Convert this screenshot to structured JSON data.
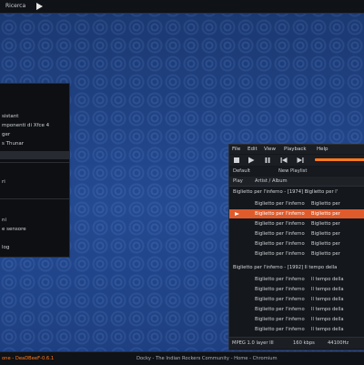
{
  "top_panel": {
    "title": "Ricerca"
  },
  "menu": {
    "items": [
      {
        "label": "sistant"
      },
      {
        "label": "mponenti di Xfce 4"
      },
      {
        "label": "ger"
      },
      {
        "label": "s Thunar"
      },
      {
        "label": ""
      },
      {
        "label": "ri"
      },
      {
        "label": "ni"
      },
      {
        "label": "e sensore"
      },
      {
        "label": "log"
      }
    ]
  },
  "player": {
    "menubar": [
      "File",
      "Edit",
      "View",
      "Playback",
      "Help"
    ],
    "tabs": {
      "default": "Default",
      "new_playlist": "New Playlist"
    },
    "columns": {
      "playing": "Play",
      "artist_album": "Artist / Album"
    },
    "groups": [
      {
        "header": "Biglietto per l'inferno - [1974] Biglietto per l'",
        "tracks": [
          {
            "artist": "Biglietto per l'inferno",
            "title": "Biglietto per"
          },
          {
            "artist": "Biglietto per l'inferno",
            "title": "Biglietto per"
          },
          {
            "artist": "Biglietto per l'inferno",
            "title": "Biglietto per"
          },
          {
            "artist": "Biglietto per l'inferno",
            "title": "Biglietto per"
          },
          {
            "artist": "Biglietto per l'inferno",
            "title": "Biglietto per"
          },
          {
            "artist": "Biglietto per l'inferno",
            "title": "Biglietto per"
          }
        ]
      },
      {
        "header": "Biglietto per l'inferno - [1992] Il tempo della",
        "tracks": [
          {
            "artist": "Biglietto per l'inferno",
            "title": "Il tempo della"
          },
          {
            "artist": "Biglietto per l'inferno",
            "title": "Il tempo della"
          },
          {
            "artist": "Biglietto per l'inferno",
            "title": "Il tempo della"
          },
          {
            "artist": "Biglietto per l'inferno",
            "title": "Il tempo della"
          },
          {
            "artist": "Biglietto per l'inferno",
            "title": "Il tempo della"
          },
          {
            "artist": "Biglietto per l'inferno",
            "title": "Il tempo della"
          }
        ]
      }
    ],
    "playing_index": 1,
    "status": {
      "format": "MPEG 1.0 layer III",
      "bitrate": "160 kbps",
      "rate": "44100Hz",
      "extra": ""
    }
  },
  "bottom_panel": {
    "left": "one - DeaDBeeF-0.6.1",
    "center": "Docky - The Indian Rockers Community - Home - Chromium"
  },
  "colors": {
    "accent": "#ff7a1e",
    "playing_row": "#e05b2b"
  }
}
